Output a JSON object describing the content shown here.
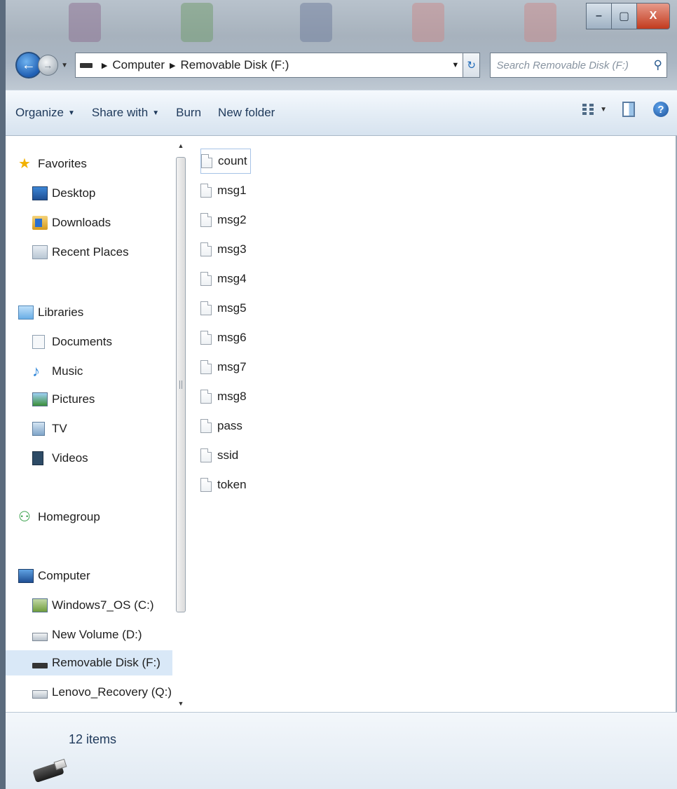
{
  "window": {
    "buttons": {
      "minimize": "–",
      "maximize": "▢",
      "close": "X"
    }
  },
  "nav": {
    "address": {
      "segments": [
        "Computer",
        "Removable Disk (F:)"
      ],
      "drive_icon": "usb-drive-icon"
    },
    "search": {
      "placeholder": "Search Removable Disk (F:)"
    }
  },
  "toolbar": {
    "organize": "Organize",
    "share_with": "Share with",
    "burn": "Burn",
    "new_folder": "New folder"
  },
  "sidebar": {
    "favorites": {
      "label": "Favorites",
      "items": [
        "Desktop",
        "Downloads",
        "Recent Places"
      ]
    },
    "libraries": {
      "label": "Libraries",
      "items": [
        "Documents",
        "Music",
        "Pictures",
        "TV",
        "Videos"
      ]
    },
    "homegroup": {
      "label": "Homegroup"
    },
    "computer": {
      "label": "Computer",
      "items": [
        "Windows7_OS (C:)",
        "New Volume (D:)",
        "Removable Disk (F:)",
        "Lenovo_Recovery (Q:)"
      ],
      "selected": "Removable Disk (F:)"
    }
  },
  "files": [
    "count",
    "msg1",
    "msg2",
    "msg3",
    "msg4",
    "msg5",
    "msg6",
    "msg7",
    "msg8",
    "pass",
    "ssid",
    "token"
  ],
  "status": {
    "item_count": "12 items"
  },
  "colors": {
    "toolbar_text": "#1e395b",
    "selection": "#d9e8f7",
    "close_button": "#c23b1e"
  }
}
